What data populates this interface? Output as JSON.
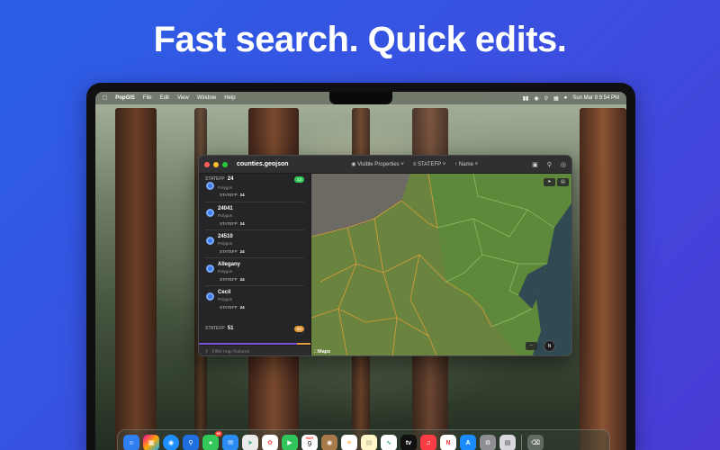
{
  "headline": "Fast search. Quick edits.",
  "menubar": {
    "apple_icon": "apple-logo",
    "items": [
      "PopGIS",
      "File",
      "Edit",
      "View",
      "Window",
      "Help"
    ],
    "datetime": "Sun Mar 9  9:54 PM"
  },
  "window": {
    "title": "counties.geojson",
    "toolbar": {
      "visible_properties": "Visible Properties",
      "group_by": "STATEFP",
      "sort_by": "Name"
    },
    "groups": [
      {
        "key": "STATEFP",
        "value": "24",
        "count": "13",
        "color": "#34c759"
      },
      {
        "key": "STATEFP",
        "value": "51",
        "count": "83",
        "color": "#e09a3a"
      }
    ],
    "features": [
      {
        "name": "",
        "type": "Polygon",
        "prop_key": "STATEFP",
        "prop_value": "24"
      },
      {
        "name": "24041",
        "type": "Polygon",
        "prop_key": "STATEFP",
        "prop_value": "24"
      },
      {
        "name": "24510",
        "type": "Polygon",
        "prop_key": "STATEFP",
        "prop_value": "24"
      },
      {
        "name": "Allegany",
        "type": "Polygon",
        "prop_key": "STATEFP",
        "prop_value": "24"
      },
      {
        "name": "Cecil",
        "type": "Polygon",
        "prop_key": "STATEFP",
        "prop_value": "24"
      }
    ],
    "filter_placeholder": "Filter map features",
    "map_attribution": "Maps",
    "compass_label": "N"
  },
  "dock": {
    "messages_badge": "99",
    "calendar": {
      "month": "MAR",
      "day": "9"
    },
    "apple_tv_label": "tv"
  },
  "colors": {
    "accent": "#3a7bf0",
    "group_green": "#34c759",
    "group_orange": "#e09a3a"
  }
}
